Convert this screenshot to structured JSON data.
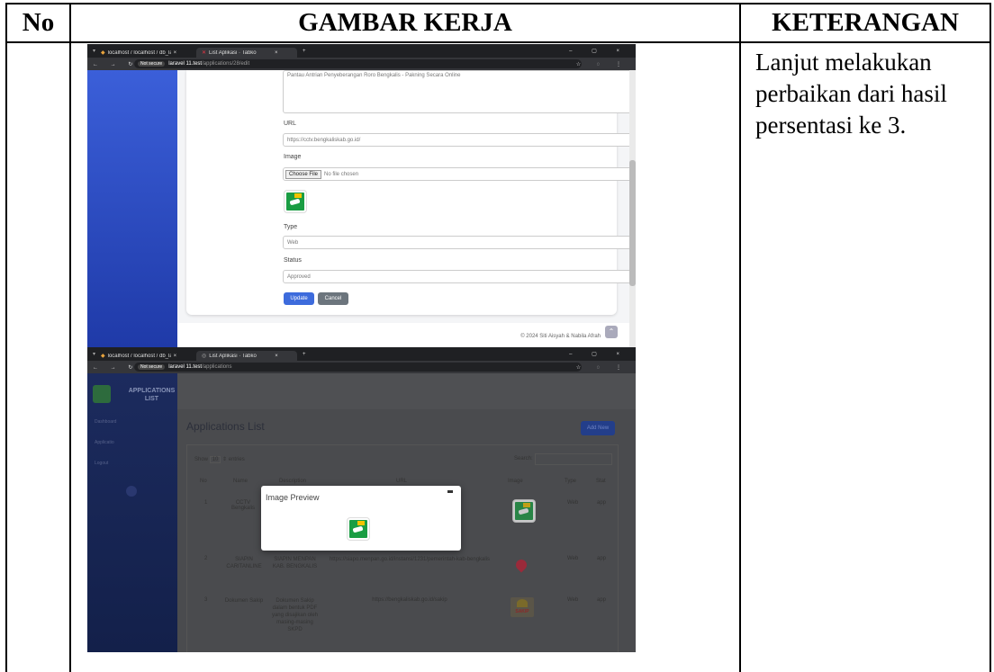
{
  "table": {
    "headers": {
      "no": "No",
      "gambar": "GAMBAR KERJA",
      "keterangan": "KETERANGAN"
    },
    "note": "Lanjut melakukan perbaikan dari hasil persentasi ke 3."
  },
  "shot1": {
    "tab1": "localhost / localhost / db_lara...",
    "tab2": "List Aplikasi · Tabko",
    "security": "Not secure",
    "url_host": "laravel 11.test",
    "url_path": "/applications/28/edit",
    "description_value": "Pantau Antrian Penyeberangan Roro Bengkalis - Pakning Secara Online",
    "url_label": "URL",
    "url_value": "https://cctv.bengkaliskab.go.id/",
    "image_label": "Image",
    "choose_file": "Choose File",
    "no_file": "No file chosen",
    "type_label": "Type",
    "type_value": "Web",
    "status_label": "Status",
    "status_value": "Approved",
    "update": "Update",
    "cancel": "Cancel",
    "footer": "© 2024 Siti Aisyah & Nabila Afrah"
  },
  "shot2": {
    "tab1": "localhost / localhost / db_lara...",
    "tab2": "List Aplikasi · Tabko",
    "security": "Not secure",
    "url_host": "laravel 11.test",
    "url_path": "/applications",
    "brand": "APPLICATIONS LIST",
    "nav": [
      "Dashboard",
      "Applicatio",
      "Logout"
    ],
    "page_title": "Applications List",
    "add_new": "Add New",
    "show": "Show",
    "entries_value": "10",
    "entries": "entries",
    "search": "Search:",
    "columns": [
      "No",
      "Name",
      "Description",
      "URL",
      "Image",
      "Type",
      "Stat"
    ],
    "rows": [
      {
        "no": "1",
        "name": "CCTV Bengkalis",
        "desc": "",
        "url": "",
        "type": "Web",
        "status": "app"
      },
      {
        "no": "2",
        "name": "SIAPIN CARITANLINE",
        "desc": "SIAPIN MENPAN KAB. BENGKALIS",
        "url": "https://siapo.menpan.go.id/instansi/1231/pemerintah-kab-bengkalis",
        "type": "Web",
        "status": "app"
      },
      {
        "no": "3",
        "name": "Dokumen Sakip",
        "desc": "Dokumen Sakip dalam bentuk PDF yang disajikan oleh masing-masing SKPD",
        "url": "https://bengkaliskab.go.id/sakip",
        "type": "Web",
        "status": "app"
      }
    ],
    "sakip_label": "SAKIP",
    "modal_title": "Image Preview"
  }
}
